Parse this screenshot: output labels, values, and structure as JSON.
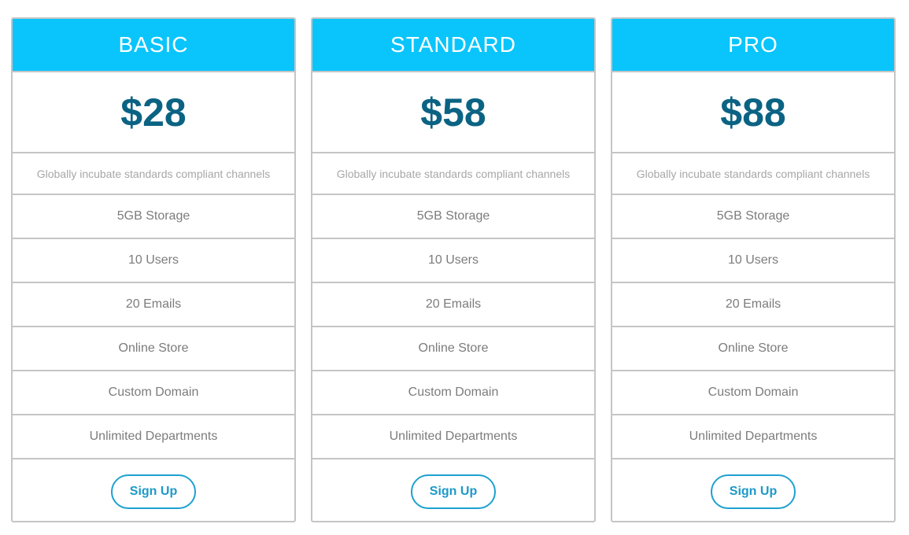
{
  "plans": [
    {
      "name": "BASIC",
      "price": "$28",
      "description": "Globally incubate standards compliant channels",
      "features": [
        "5GB Storage",
        "10 Users",
        "20 Emails",
        "Online Store",
        "Custom Domain",
        "Unlimited Departments"
      ],
      "cta": "Sign Up"
    },
    {
      "name": "STANDARD",
      "price": "$58",
      "description": "Globally incubate standards compliant channels",
      "features": [
        "5GB Storage",
        "10 Users",
        "20 Emails",
        "Online Store",
        "Custom Domain",
        "Unlimited Departments"
      ],
      "cta": "Sign Up"
    },
    {
      "name": "PRO",
      "price": "$88",
      "description": "Globally incubate standards compliant channels",
      "features": [
        "5GB Storage",
        "10 Users",
        "20 Emails",
        "Online Store",
        "Custom Domain",
        "Unlimited Departments"
      ],
      "cta": "Sign Up"
    }
  ],
  "colors": {
    "header_bg": "#09c5fc",
    "price_text": "#0b6383",
    "button_accent": "#1c99c8",
    "border": "#c5c5c5"
  }
}
